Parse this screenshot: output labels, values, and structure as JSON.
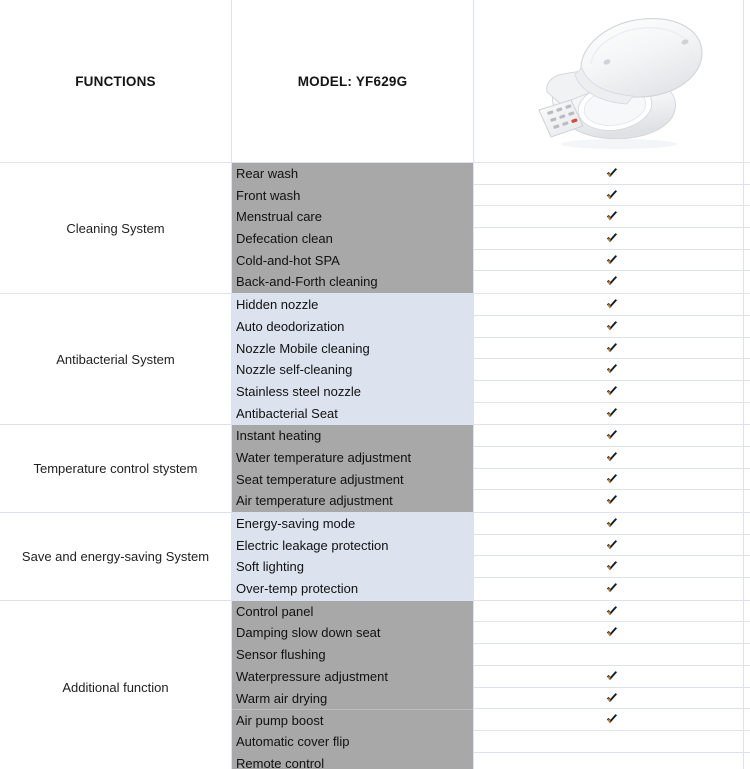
{
  "header": {
    "functions_label": "FUNCTIONS",
    "model_label": "MODEL: YF629G",
    "product_image_alt": "bidet-toilet-seat"
  },
  "colors": {
    "shade_gray": "#a8a8a8",
    "shade_blue": "#dce3ee",
    "border": "#dde2ee",
    "check_dark": "#1a1a1a",
    "check_accent": "#e08a14",
    "check_blue": "#4a6fa5",
    "text": "#111111"
  },
  "check_glyph": "✔",
  "sections": [
    {
      "category": "Cleaning System",
      "shade": "shade-gray",
      "rows": [
        {
          "feature": "Rear wash",
          "supported": true
        },
        {
          "feature": "Front wash",
          "supported": true
        },
        {
          "feature": "Menstrual care",
          "supported": true
        },
        {
          "feature": "Defecation clean",
          "supported": true
        },
        {
          "feature": "Cold-and-hot SPA",
          "supported": true
        },
        {
          "feature": "Back-and-Forth cleaning",
          "supported": true
        }
      ]
    },
    {
      "category": "Antibacterial System",
      "shade": "shade-blue",
      "rows": [
        {
          "feature": "Hidden nozzle",
          "supported": true
        },
        {
          "feature": "Auto deodorization",
          "supported": true
        },
        {
          "feature": "Nozzle Mobile cleaning",
          "supported": true
        },
        {
          "feature": "Nozzle self-cleaning",
          "supported": true
        },
        {
          "feature": "Stainless steel nozzle",
          "supported": true
        },
        {
          "feature": "Antibacterial Seat",
          "supported": true
        }
      ]
    },
    {
      "category": "Temperature control stystem",
      "shade": "shade-gray",
      "rows": [
        {
          "feature": "Instant heating",
          "supported": true
        },
        {
          "feature": "Water temperature adjustment",
          "supported": true
        },
        {
          "feature": "Seat temperature adjustment",
          "supported": true
        },
        {
          "feature": "Air temperature adjustment",
          "supported": true
        }
      ]
    },
    {
      "category": "Save and energy-saving System",
      "shade": "shade-blue",
      "rows": [
        {
          "feature": "Energy-saving mode",
          "supported": true
        },
        {
          "feature": "Electric leakage protection",
          "supported": true
        },
        {
          "feature": "Soft lighting",
          "supported": true
        },
        {
          "feature": "Over-temp protection",
          "supported": true
        }
      ]
    },
    {
      "category": "Additional function",
      "shade": "shade-gray",
      "rows": [
        {
          "feature": "Control panel",
          "supported": true
        },
        {
          "feature": "Damping slow down seat",
          "supported": true
        },
        {
          "feature": "Sensor flushing",
          "supported": false
        },
        {
          "feature": "Waterpressure adjustment",
          "supported": true
        },
        {
          "feature": "Warm air drying",
          "supported": true
        },
        {
          "feature": "Air pump boost",
          "supported": true,
          "divider_above": true
        },
        {
          "feature": "Automatic cover flip",
          "supported": false
        },
        {
          "feature": "Remote control",
          "supported": false
        }
      ]
    }
  ]
}
